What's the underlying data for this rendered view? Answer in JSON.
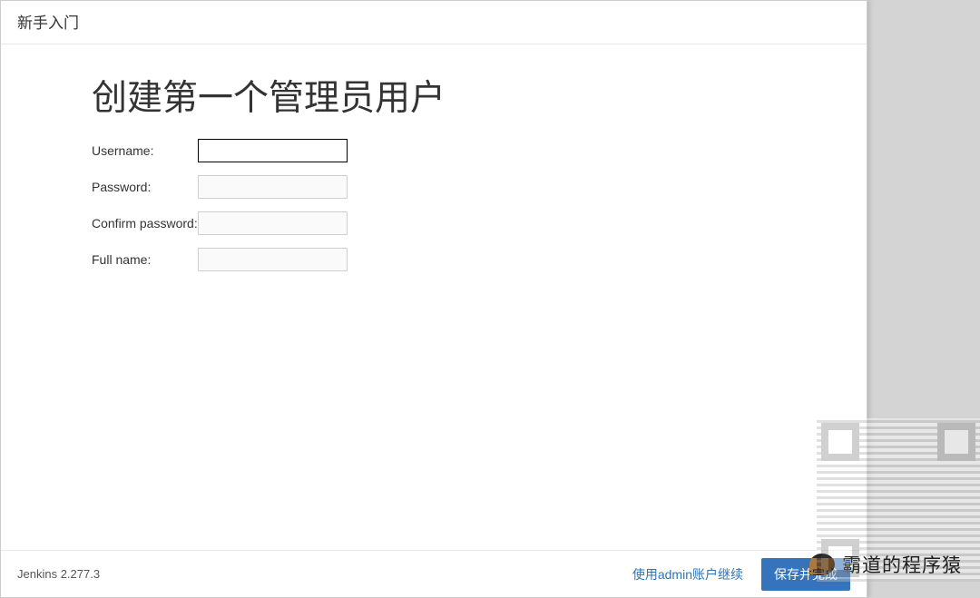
{
  "header": {
    "title": "新手入门"
  },
  "main": {
    "heading": "创建第一个管理员用户",
    "fields": {
      "username": {
        "label": "Username:",
        "value": ""
      },
      "password": {
        "label": "Password:",
        "value": ""
      },
      "confirm": {
        "label": "Confirm password:",
        "value": ""
      },
      "fullname": {
        "label": "Full name:",
        "value": ""
      }
    }
  },
  "footer": {
    "version": "Jenkins 2.277.3",
    "skip_label": "使用admin账户继续",
    "save_label": "保存并完成"
  },
  "watermark": {
    "text": "霸道的程序猿"
  }
}
